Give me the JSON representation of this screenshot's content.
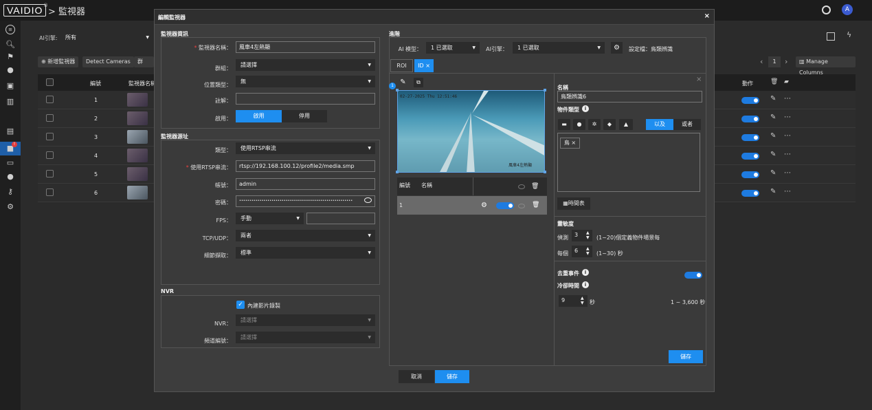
{
  "app": {
    "logo": "VAIDIO",
    "reg": "®",
    "breadcrumb": "> 監視器",
    "user_initial": "A"
  },
  "sidebar": {
    "icons": [
      "menu-icon",
      "search-icon",
      "running-person-icon",
      "bell-icon",
      "face-scan-icon",
      "chart-icon",
      "document-icon",
      "camera-icon",
      "badge-icon",
      "users-icon",
      "key-icon",
      "settings-gears-icon"
    ],
    "badge": "!"
  },
  "bg": {
    "filter_label": "AI引擎:",
    "filter_value": "所有",
    "add_btn": "⊕ 新增監視器",
    "detect_btn": "Detect Cameras",
    "group_btn": "群",
    "page": "1",
    "manage_columns": "Manage Columns",
    "col_no": "編號",
    "col_name": "監視器名稱",
    "col_action": "動作",
    "rows": [
      "1",
      "2",
      "3",
      "4",
      "5",
      "6"
    ]
  },
  "modal": {
    "title": "編輯監視器",
    "close": "×",
    "info": {
      "section": "監視器資訊",
      "name_label": "監視器名稱：",
      "name_value": "風車4左熱顯",
      "group_label": "群組：",
      "group_value": "請選擇",
      "loc_label": "位置類型：",
      "loc_value": "無",
      "note_label": "註解：",
      "note_value": "",
      "enable_label": "啟用：",
      "enable_on": "啟用",
      "enable_off": "停用"
    },
    "source": {
      "section": "監視器源址",
      "type_label": "類型：",
      "type_value": "使用RTSP串流",
      "rtsp_label": "使用RTSP串流：",
      "rtsp_value": "rtsp://192.168.100.12/profile2/media.smp",
      "user_label": "帳號：",
      "user_value": "admin",
      "pwd_label": "密碼：",
      "pwd_value": "••••••••••••••••••••••••••••••••••••••••••••••••••••••••",
      "fps_label": "FPS：",
      "fps_value": "手動",
      "fps_input": "",
      "tcp_label": "TCP/UDP：",
      "tcp_value": "兩者",
      "detail_label": "細節擷取：",
      "detail_value": "標準"
    },
    "nvr": {
      "section": "NVR",
      "builtin_label": "內建影片錄製",
      "nvr_label": "NVR：",
      "nvr_value": "請選擇",
      "ch_label": "頻道編號：",
      "ch_value": "請選擇"
    },
    "advanced": {
      "section": "進階",
      "model_label": "AI 模型：",
      "model_value": "1 已選取",
      "engine_label": "AI引擎：",
      "engine_value": "1 已選取",
      "setting_label": "設定檔：鳥類辨識",
      "tab_roi": "ROI",
      "tab_id": "ID",
      "tab_id_close": "×",
      "img_ts": "02-27-2025 Thu 12:51:46",
      "img_wm": "風車4左熱顯",
      "roi_badge": "1",
      "table_no": "編號",
      "table_name": "名稱",
      "row_no": "1"
    },
    "detail": {
      "close": "×",
      "name_label": "名稱",
      "name_value": "鳥類辨識6",
      "type_label": "物件類型",
      "and": "以及",
      "or": "或者",
      "tag": "鳥 ×",
      "schedule": "時間表",
      "sens_title": "靈敏度",
      "detect_label": "偵測",
      "detect_value": "3",
      "detect_hint": "(1~20)個定義物件場景每",
      "every_label": "每個",
      "every_value": "6",
      "every_hint": "(1~30) 秒",
      "dedup_label": "去重事件",
      "cool_label": "冷卻時間",
      "cool_value": "9",
      "cool_unit": "秒",
      "cool_range": "1 ~ 3,600 秒",
      "save": "儲存"
    },
    "footer": {
      "cancel": "取消",
      "save": "儲存"
    }
  },
  "colors": {
    "accent": "#1e8ef0",
    "danger": "#e23b3b"
  }
}
